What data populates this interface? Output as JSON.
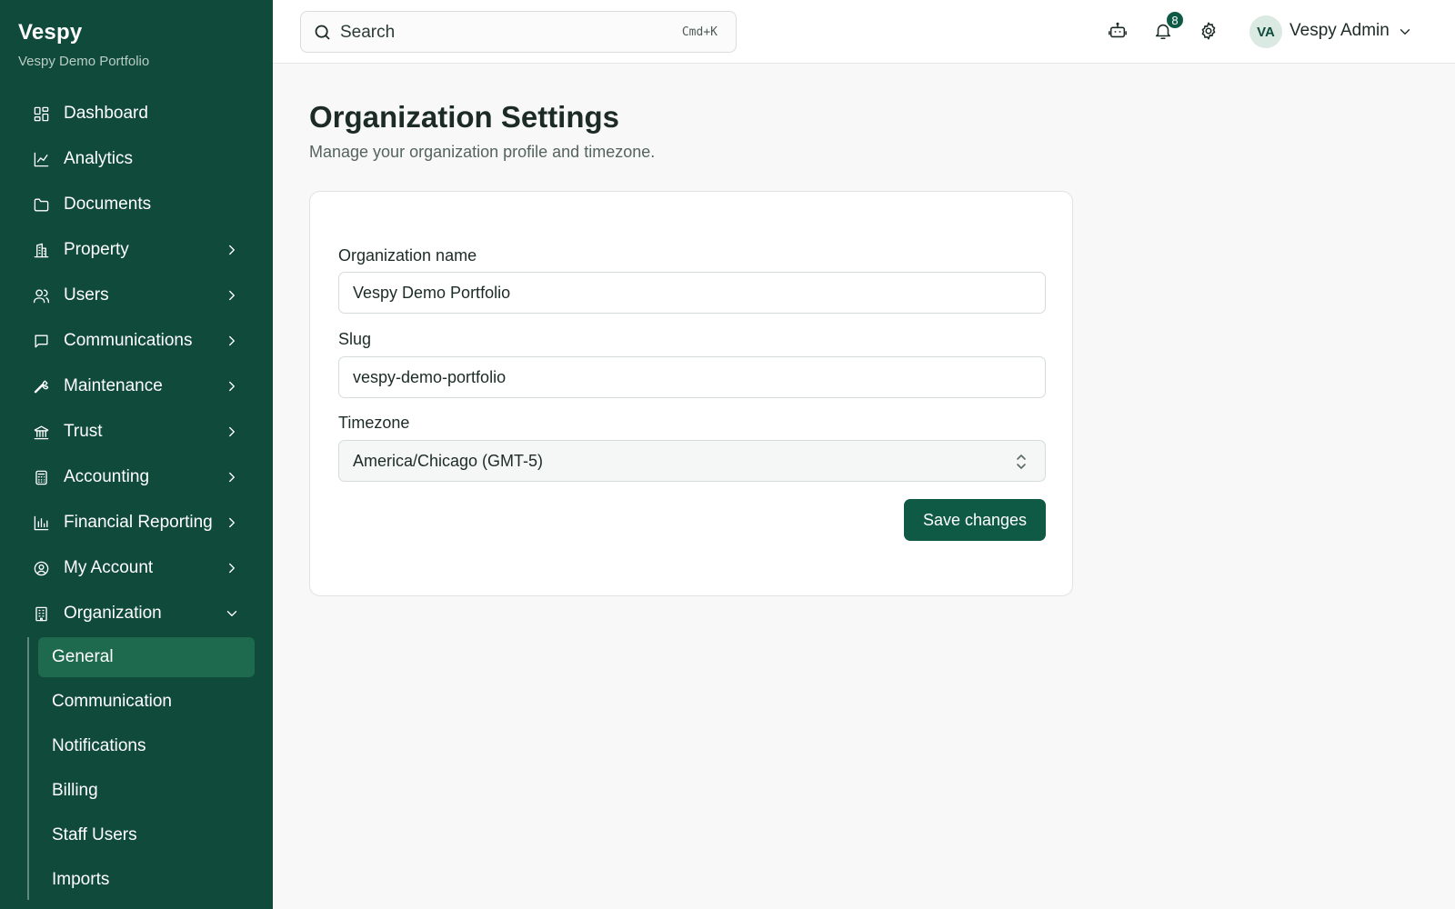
{
  "brand": {
    "name": "Vespy",
    "subtitle": "Vespy Demo Portfolio"
  },
  "sidebar": {
    "items": [
      {
        "label": "Dashboard",
        "icon": "dashboard-icon",
        "has_chevron": false
      },
      {
        "label": "Analytics",
        "icon": "line-chart-icon",
        "has_chevron": false
      },
      {
        "label": "Documents",
        "icon": "folder-icon",
        "has_chevron": false
      },
      {
        "label": "Property",
        "icon": "building-icon",
        "has_chevron": true
      },
      {
        "label": "Users",
        "icon": "users-icon",
        "has_chevron": true
      },
      {
        "label": "Communications",
        "icon": "message-icon",
        "has_chevron": true
      },
      {
        "label": "Maintenance",
        "icon": "wrench-icon",
        "has_chevron": true
      },
      {
        "label": "Trust",
        "icon": "bank-icon",
        "has_chevron": true
      },
      {
        "label": "Accounting",
        "icon": "calculator-icon",
        "has_chevron": true
      },
      {
        "label": "Financial Reporting",
        "icon": "bar-chart-icon",
        "has_chevron": true
      },
      {
        "label": "My Account",
        "icon": "user-circle-icon",
        "has_chevron": true
      },
      {
        "label": "Organization",
        "icon": "office-icon",
        "has_chevron": true,
        "expanded": true
      }
    ],
    "organization_subitems": [
      {
        "label": "General",
        "active": true
      },
      {
        "label": "Communication",
        "active": false
      },
      {
        "label": "Notifications",
        "active": false
      },
      {
        "label": "Billing",
        "active": false
      },
      {
        "label": "Staff Users",
        "active": false
      },
      {
        "label": "Imports",
        "active": false
      }
    ]
  },
  "topbar": {
    "search_placeholder": "Search",
    "search_shortcut": "Cmd+K",
    "notification_count": "8",
    "user_initials": "VA",
    "user_name": "Vespy Admin",
    "icons": [
      "bot-icon",
      "bell-icon",
      "gear-icon",
      "chevron-down-icon"
    ]
  },
  "main": {
    "title": "Organization Settings",
    "subtitle": "Manage your organization profile and timezone.",
    "form": {
      "org_name_label": "Organization name",
      "org_name_value": "Vespy Demo Portfolio",
      "slug_label": "Slug",
      "slug_value": "vespy-demo-portfolio",
      "timezone_label": "Timezone",
      "timezone_value": "America/Chicago (GMT-5)",
      "save_label": "Save changes"
    }
  },
  "colors": {
    "sidebar_bg": "#0f4a3a",
    "active_item": "#1d6a4f",
    "primary_button": "#0f5a44",
    "page_bg": "#f7f8f7"
  }
}
